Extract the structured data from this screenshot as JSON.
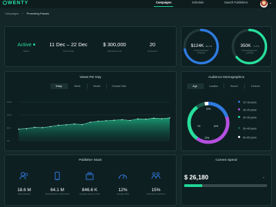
{
  "app": {
    "logo": "WENTY"
  },
  "nav": {
    "items": [
      "Campaigns",
      "Schedule",
      "Search Publishers"
    ]
  },
  "breadcrumb": {
    "parent": "Campaigns",
    "current": "Promoting Passes"
  },
  "stats": [
    {
      "value": "Active",
      "label": "Status"
    },
    {
      "value": "11 Dec – 22 Dec",
      "label": "Time Frame"
    },
    {
      "value": "$ 300,000",
      "label": "Estimated Cost"
    },
    {
      "value": "20",
      "label": "Promoters"
    }
  ],
  "goals": [
    {
      "value": "$124K",
      "suffix": "/ $2.4 M",
      "label1": "Actual Investment",
      "label2": "$750,000",
      "progress": 0.72,
      "color": "#2f7be0"
    },
    {
      "value": "350K",
      "suffix": "/ 2.4 M",
      "label1": "Actual Engagement",
      "label2": "1,200,000",
      "progress": 0.64,
      "color": "#27de9b"
    }
  ],
  "views": {
    "title": "Views Per Day",
    "tabs": [
      "Today",
      "Week",
      "Month",
      "Choose Date"
    ],
    "ylabels": [
      "150 K",
      "100 K",
      "50 K",
      "0 K"
    ]
  },
  "chart_data": {
    "type": "area",
    "title": "Views Per Day",
    "ylim": [
      0,
      150
    ],
    "values": [
      45,
      47,
      52,
      51,
      55,
      60,
      62,
      65,
      63,
      72,
      76,
      78,
      80,
      82,
      79,
      85,
      84,
      88,
      86,
      89
    ]
  },
  "audience": {
    "title": "Audience Demographics",
    "tabs": [
      "Age",
      "Location",
      "Source",
      "Devices"
    ],
    "slices": [
      {
        "label": "12–18 years",
        "percent": 20,
        "color": "#2f7be0"
      },
      {
        "label": "18–25 years",
        "percent": 40,
        "color": "#b44fe0"
      },
      {
        "label": "25–35 years",
        "percent": 30,
        "color": "#27de9b"
      },
      {
        "label": "35–45 years",
        "percent": 7,
        "color": "#1c5a4c"
      },
      {
        "label": "50–65 years",
        "percent": 3,
        "color": "#ffffff"
      }
    ],
    "slice_labels": [
      "20%",
      "40%",
      "7%",
      "30%"
    ]
  },
  "publisher": {
    "title": "Publisher Stack",
    "items": [
      {
        "icon": "users-icon",
        "value": "18.6 M",
        "label": "Total Followers"
      },
      {
        "icon": "phone-icon",
        "value": "64.1 M",
        "label": "Total Followers of Promoters"
      },
      {
        "icon": "stack-icon",
        "value": "846.6 K",
        "label": "Average Views per Post"
      },
      {
        "icon": "gauge-icon",
        "value": "12%",
        "label": "Average CPM"
      },
      {
        "icon": "team-icon",
        "value": "15%",
        "label": "Audience Conversion"
      }
    ]
  },
  "spend": {
    "title": "Current Spend",
    "value": "$ 26,180",
    "progress": 0.22
  }
}
